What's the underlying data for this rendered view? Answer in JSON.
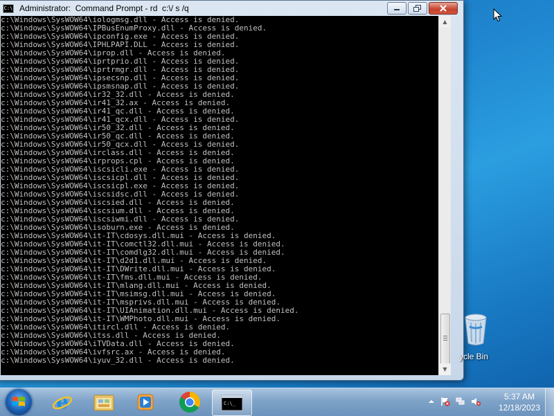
{
  "window": {
    "title": "Administrator:  Command Prompt - rd  c:\\/ s /q",
    "icon_label": "C:\\"
  },
  "console": {
    "lines": [
      "c:\\Windows\\SysWOW64\\iologmsg.dll - Access is denied.",
      "c:\\Windows\\SysWOW64\\IPBusEnumProxy.dll - Access is denied.",
      "c:\\Windows\\SysWOW64\\ipconfig.exe - Access is denied.",
      "c:\\Windows\\SysWOW64\\IPHLPAPI.DLL - Access is denied.",
      "c:\\Windows\\SysWOW64\\iprop.dll - Access is denied.",
      "c:\\Windows\\SysWOW64\\iprtprio.dll - Access is denied.",
      "c:\\Windows\\SysWOW64\\iprtrmgr.dll - Access is denied.",
      "c:\\Windows\\SysWOW64\\ipsecsnp.dll - Access is denied.",
      "c:\\Windows\\SysWOW64\\ipsmsnap.dll - Access is denied.",
      "c:\\Windows\\SysWOW64\\ir32_32.dll - Access is denied.",
      "c:\\Windows\\SysWOW64\\ir41_32.ax - Access is denied.",
      "c:\\Windows\\SysWOW64\\ir41_qc.dll - Access is denied.",
      "c:\\Windows\\SysWOW64\\ir41_qcx.dll - Access is denied.",
      "c:\\Windows\\SysWOW64\\ir50_32.dll - Access is denied.",
      "c:\\Windows\\SysWOW64\\ir50_qc.dll - Access is denied.",
      "c:\\Windows\\SysWOW64\\ir50_qcx.dll - Access is denied.",
      "c:\\Windows\\SysWOW64\\irclass.dll - Access is denied.",
      "c:\\Windows\\SysWOW64\\irprops.cpl - Access is denied.",
      "c:\\Windows\\SysWOW64\\iscsicli.exe - Access is denied.",
      "c:\\Windows\\SysWOW64\\iscsicpl.dll - Access is denied.",
      "c:\\Windows\\SysWOW64\\iscsicpl.exe - Access is denied.",
      "c:\\Windows\\SysWOW64\\iscsidsc.dll - Access is denied.",
      "c:\\Windows\\SysWOW64\\iscsied.dll - Access is denied.",
      "c:\\Windows\\SysWOW64\\iscsium.dll - Access is denied.",
      "c:\\Windows\\SysWOW64\\iscsiwmi.dll - Access is denied.",
      "c:\\Windows\\SysWOW64\\isoburn.exe - Access is denied.",
      "c:\\Windows\\SysWOW64\\it-IT\\cdosys.dll.mui - Access is denied.",
      "c:\\Windows\\SysWOW64\\it-IT\\comctl32.dll.mui - Access is denied.",
      "c:\\Windows\\SysWOW64\\it-IT\\comdlg32.dll.mui - Access is denied.",
      "c:\\Windows\\SysWOW64\\it-IT\\d2d1.dll.mui - Access is denied.",
      "c:\\Windows\\SysWOW64\\it-IT\\DWrite.dll.mui - Access is denied.",
      "c:\\Windows\\SysWOW64\\it-IT\\fms.dll.mui - Access is denied.",
      "c:\\Windows\\SysWOW64\\it-IT\\mlang.dll.mui - Access is denied.",
      "c:\\Windows\\SysWOW64\\it-IT\\msimsg.dll.mui - Access is denied.",
      "c:\\Windows\\SysWOW64\\it-IT\\msprivs.dll.mui - Access is denied.",
      "c:\\Windows\\SysWOW64\\it-IT\\UIAnimation.dll.mui - Access is denied.",
      "c:\\Windows\\SysWOW64\\it-IT\\WMPhoto.dll.mui - Access is denied.",
      "c:\\Windows\\SysWOW64\\itircl.dll - Access is denied.",
      "c:\\Windows\\SysWOW64\\itss.dll - Access is denied.",
      "c:\\Windows\\SysWOW64\\iTVData.dll - Access is denied.",
      "c:\\Windows\\SysWOW64\\ivfsrc.ax - Access is denied.",
      "c:\\Windows\\SysWOW64\\iyuv_32.dll - Access is denied."
    ]
  },
  "desktop": {
    "recycle_bin_label": "ycle Bin"
  },
  "taskbar": {
    "apps": [
      "internet-explorer",
      "windows-explorer",
      "windows-media-player",
      "google-chrome",
      "command-prompt"
    ],
    "active_app": "command-prompt"
  },
  "clock": {
    "time": "5:37 AM",
    "date": "12/18/2023"
  },
  "colors": {
    "console_bg": "#000000",
    "console_text": "#c0c0c0",
    "taskbar": "#7fa3c8",
    "desktop": "#1f86cf"
  }
}
